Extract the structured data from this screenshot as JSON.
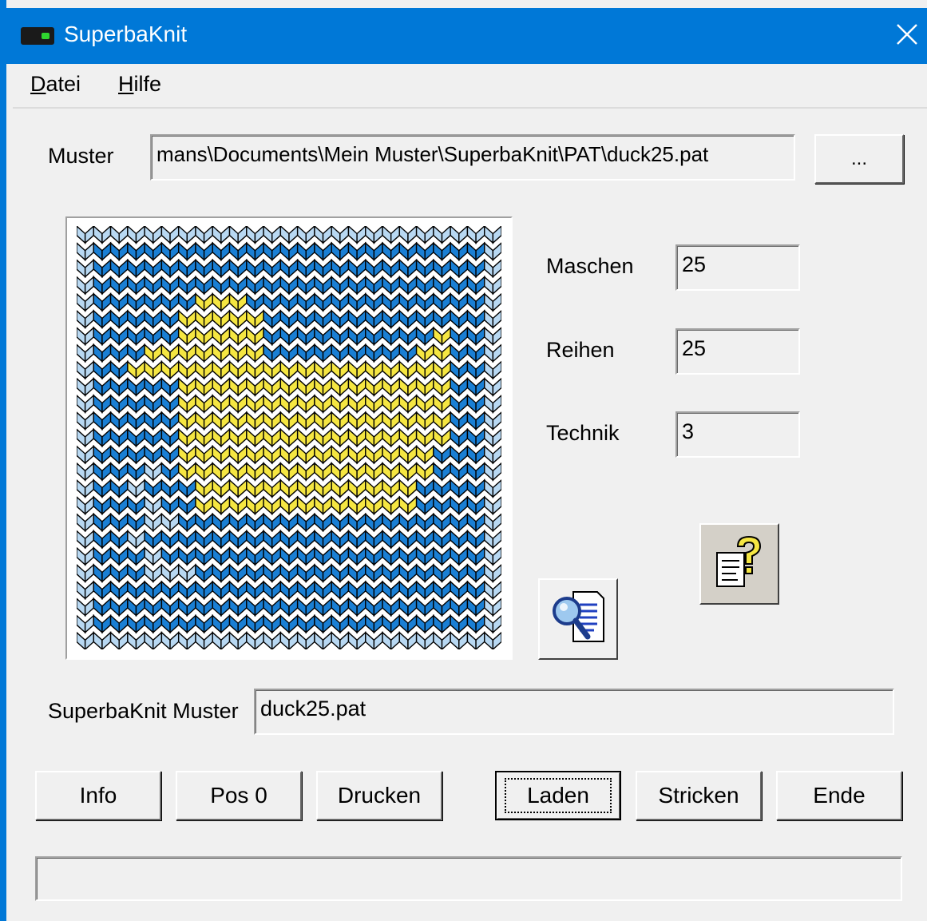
{
  "window": {
    "title": "SuperbaKnit",
    "close_glyph": "✕",
    "title_bar_color": "#0078d7"
  },
  "menu": {
    "items": [
      {
        "accel": "D",
        "rest": "atei"
      },
      {
        "accel": "H",
        "rest": "ilfe"
      }
    ]
  },
  "muster": {
    "label": "Muster",
    "value": "mans\\Documents\\Mein Muster\\SuperbaKnit\\PAT\\duck25.pat",
    "browse_label": "..."
  },
  "stats": {
    "maschen_label": "Maschen",
    "maschen_value": "25",
    "reihen_label": "Reihen",
    "reihen_value": "25",
    "technik_label": "Technik",
    "technik_value": "3"
  },
  "pattern": {
    "colors": {
      "background": "#1a7fd4",
      "motif": "#f5e642",
      "light": "#b8d8f2",
      "outline": "#000000"
    },
    "icons": {
      "help": "help-document-icon",
      "preview": "magnifier-document-icon"
    }
  },
  "superba_muster": {
    "label": "SuperbaKnit Muster",
    "value": "duck25.pat"
  },
  "buttons": {
    "info": "Info",
    "pos0": "Pos 0",
    "drucken": "Drucken",
    "laden": "Laden",
    "stricken": "Stricken",
    "ende": "Ende"
  },
  "status": {
    "text": ""
  }
}
